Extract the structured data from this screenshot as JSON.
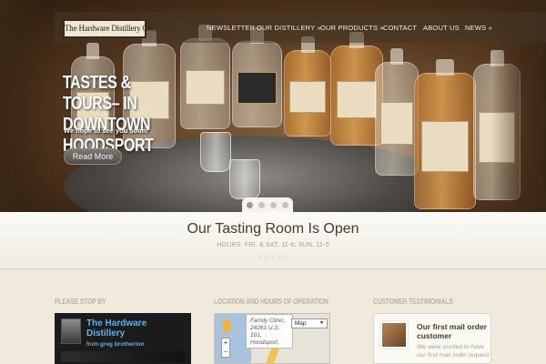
{
  "header": {
    "logo_text": "The Hardware Distillery Co.",
    "nav": [
      {
        "label": "NEWSLETTER",
        "id": "newsletter"
      },
      {
        "label": "OUR DISTILLERY »",
        "id": "our-distillery"
      },
      {
        "label": "OUR PRODUCTS »",
        "id": "our-products"
      },
      {
        "label": "CONTACT",
        "id": "contact"
      },
      {
        "label": "ABOUT US",
        "id": "about-us"
      },
      {
        "label": "NEWS »",
        "id": "news"
      }
    ]
  },
  "hero": {
    "title": "TASTES & TOURS– IN DOWNTOWN HOODSPORT",
    "subtitle": "We hope to see you soon!",
    "button_label": "Read More",
    "slides": 4,
    "active_slide": 1
  },
  "tasting": {
    "title": "Our Tasting Room Is Open",
    "hours": "HOURS: FRI. & SAT. 11-6; SUN. 11-5",
    "stars": "☆☆☆☆☆"
  },
  "columns": {
    "visit": {
      "heading": "PLEASE STOP BY",
      "card_title": "The Hardware Distillery",
      "card_from_prefix": "from",
      "card_from_name": "greg brotherton"
    },
    "location": {
      "heading": "LOCATION AND HOURS OF OPERATION",
      "popup_line1": "Family Clinic,",
      "popup_line2": "24261 U.S.",
      "popup_line3": "101,",
      "popup_line4": "Hoodsport,",
      "map_type": "Map",
      "zoom_in": "+",
      "zoom_out": "−"
    },
    "testimonials": {
      "heading": "CUSTOMER TESTIMONIALS",
      "title": "Our first mail order customer",
      "text": "We were excited to have our first mail order request"
    }
  },
  "colors": {
    "background": "#efeadb",
    "accent_text": "#4a3a2a",
    "link_blue": "#5eb0f0"
  }
}
